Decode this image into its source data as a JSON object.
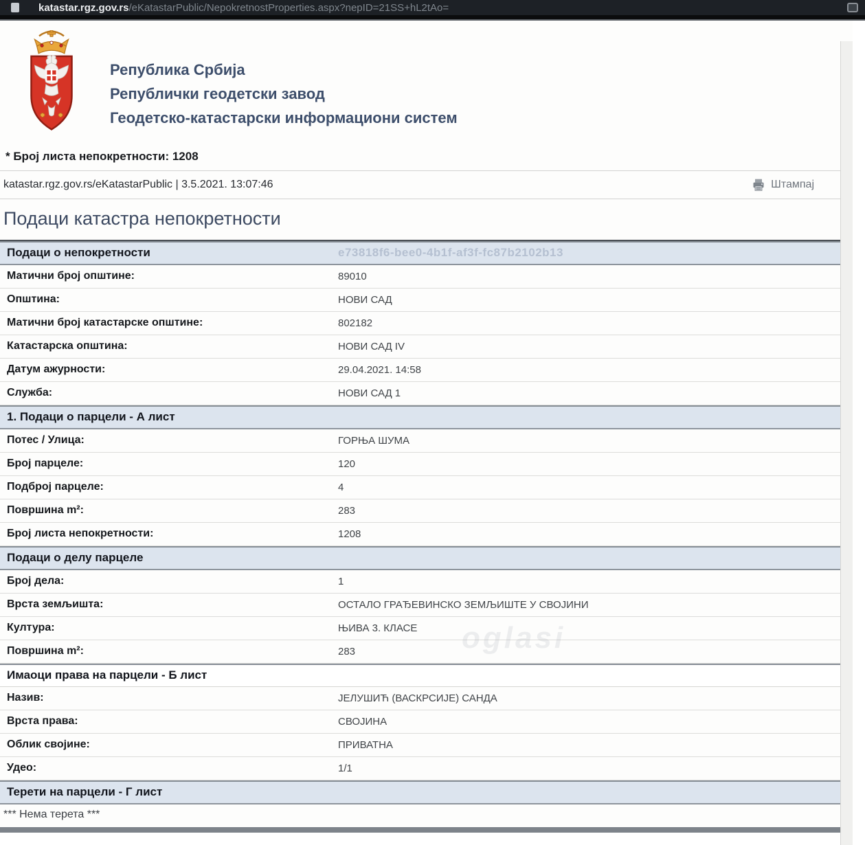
{
  "browser": {
    "url_domain": "katastar.rgz.gov.rs",
    "url_path": "/eKatastarPublic/NepokretnostProperties.aspx?nepID=21SS+hL2tAo=",
    "page_icon": "page-icon",
    "action_icon": "browser-action-icon"
  },
  "header": {
    "logo": "serbia-coat-of-arms",
    "line1": "Република Србија",
    "line2": "Републички геодетски завод",
    "line3": "Геодетско-катастарски информациони систем"
  },
  "meta": {
    "sheet_line": "* Број листа непокретности: 1208",
    "source_line": "katastar.rgz.gov.rs/eKatastarPublic | 3.5.2021. 13:07:46",
    "print_label": "Штампај",
    "print_icon": "printer-icon"
  },
  "page_title": "Подаци катастра непокретности",
  "watermark": "oglasi",
  "sections": [
    {
      "header": "Подаци о непокретности",
      "header_right": "e73818f6-bee0-4b1f-af3f-fc87b2102b13",
      "rows": [
        {
          "label": "Матични број општине:",
          "value": "89010"
        },
        {
          "label": "Општина:",
          "value": "НОВИ САД"
        },
        {
          "label": "Матични број катастарске општине:",
          "value": "802182"
        },
        {
          "label": "Катастарска општина:",
          "value": "НОВИ САД IV"
        },
        {
          "label": "Датум ажурности:",
          "value": "29.04.2021. 14:58"
        },
        {
          "label": "Служба:",
          "value": "НОВИ САД 1"
        }
      ]
    },
    {
      "header": "1. Подаци о парцели - А лист",
      "rows": [
        {
          "label": "Потес / Улица:",
          "value": "ГОРЊА ШУМА"
        },
        {
          "label": "Број парцеле:",
          "value": "120"
        },
        {
          "label": "Подброј парцеле:",
          "value": "4"
        },
        {
          "label": "Површина m²:",
          "value": "283"
        },
        {
          "label": "Број листа непокретности:",
          "value": "1208"
        }
      ]
    },
    {
      "header": "Подаци о делу парцеле",
      "rows": [
        {
          "label": "Број дела:",
          "value": "1"
        },
        {
          "label": "Врста земљишта:",
          "value": "ОСТАЛО ГРАЂЕВИНСКО ЗЕМЉИШТЕ У СВОЈИНИ"
        },
        {
          "label": "Култура:",
          "value": "ЊИВА 3. КЛАСЕ"
        },
        {
          "label": "Површина m²:",
          "value": "283"
        }
      ]
    },
    {
      "header": "Имаоци права на парцели - Б лист",
      "rows": [
        {
          "label": "Назив:",
          "value": "ЈЕЛУШИЋ (ВАСКРСИЈЕ) САНДА"
        },
        {
          "label": "Врста права:",
          "value": "СВОЈИНА"
        },
        {
          "label": "Облик својине:",
          "value": "ПРИВАТНА"
        },
        {
          "label": "Удео:",
          "value": "1/1"
        }
      ]
    },
    {
      "header": "Терети на парцели - Г лист",
      "note": "*** Нема терета ***"
    }
  ],
  "colors": {
    "section_header_bg": "#dce4ee",
    "masthead_text": "#3d4e6b",
    "guid_text": "#b5c0d1",
    "shield_red": "#d63426",
    "crown_gold": "#e9a73b",
    "urlbar_bg": "#1d2126"
  }
}
